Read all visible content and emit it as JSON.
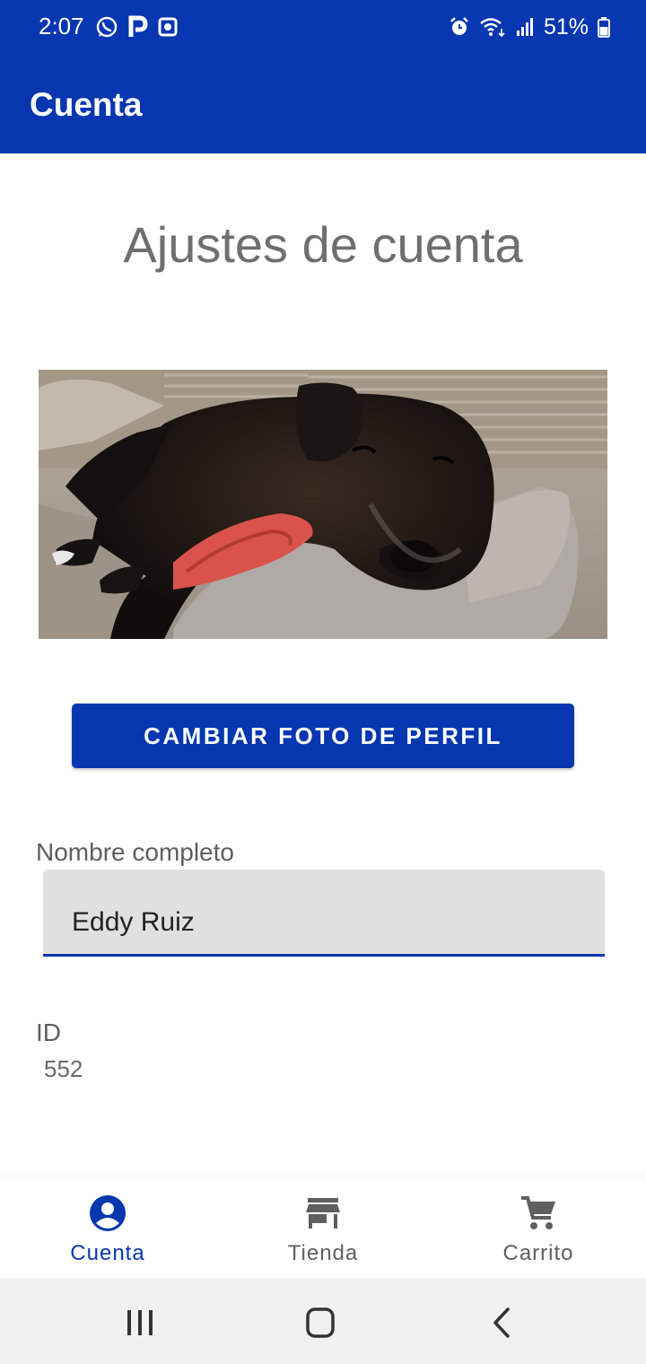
{
  "status_bar": {
    "time": "2:07",
    "battery": "51%",
    "left_icons": [
      "whatsapp-icon",
      "parking-icon",
      "record-icon"
    ],
    "right_icons": [
      "alarm-icon",
      "wifi-icon",
      "signal-icon",
      "battery-icon"
    ]
  },
  "app_bar": {
    "title": "Cuenta"
  },
  "main": {
    "heading": "Ajustes de cuenta",
    "change_photo_label": "CAMBIAR FOTO DE PERFIL",
    "full_name_label": "Nombre completo",
    "full_name_value": "Eddy Ruiz",
    "id_label": "ID",
    "id_value": "552"
  },
  "bottom_nav": {
    "items": [
      {
        "label": "Cuenta",
        "icon": "account-icon",
        "active": true
      },
      {
        "label": "Tienda",
        "icon": "store-icon",
        "active": false
      },
      {
        "label": "Carrito",
        "icon": "cart-icon",
        "active": false
      }
    ]
  },
  "system_nav": {
    "buttons": [
      "recents-icon",
      "home-icon",
      "back-icon"
    ]
  },
  "colors": {
    "primary": "#0637b0",
    "inactive": "#5f5f5f",
    "field_bg": "#e0e0e0"
  }
}
